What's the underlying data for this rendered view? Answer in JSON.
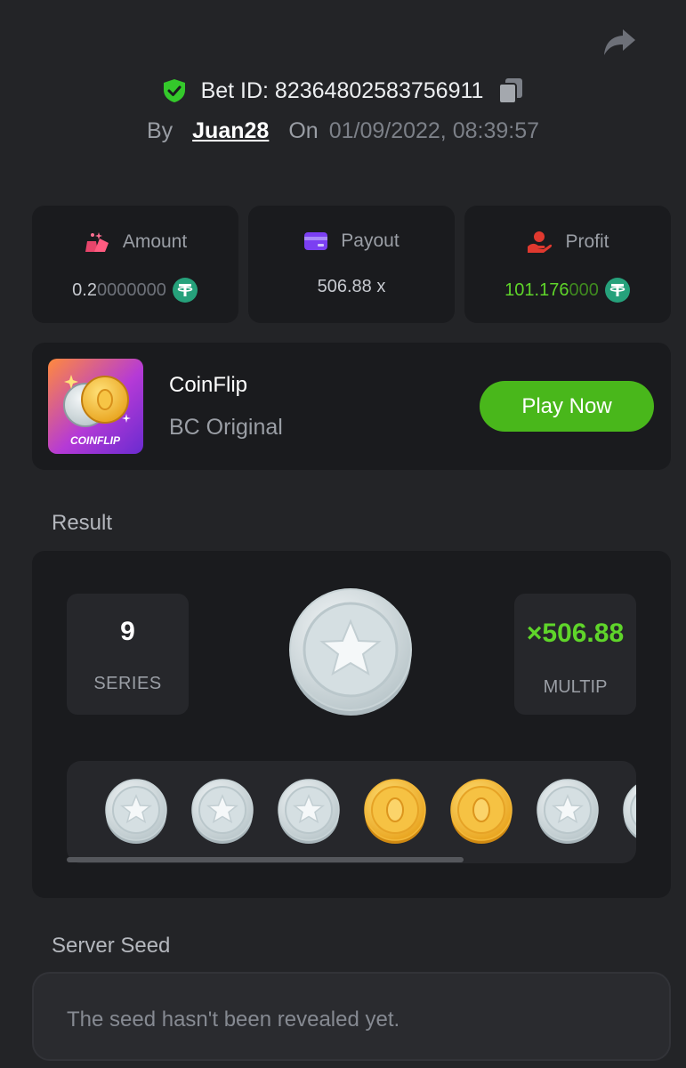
{
  "header": {
    "bet_id": "Bet ID: 82364802583756911",
    "by_label": "By",
    "username": "Juan28",
    "on_label": "On",
    "datetime": "01/09/2022, 08:39:57"
  },
  "stats": {
    "amount": {
      "label": "Amount",
      "value_main": "0.2",
      "value_dim": "0000000",
      "icon": "amount-icon"
    },
    "payout": {
      "label": "Payout",
      "value": "506.88 x",
      "icon": "payout-icon"
    },
    "profit": {
      "label": "Profit",
      "value_main": "101.176",
      "value_dim": "000",
      "icon": "profit-icon"
    }
  },
  "game": {
    "name": "CoinFlip",
    "provider": "BC Original",
    "thumb_label": "COINFLIP",
    "play_label": "Play Now"
  },
  "result": {
    "title": "Result",
    "series_value": "9",
    "series_label": "SERIES",
    "multiplier": "×506.88",
    "multiplier_label": "MULTIP",
    "main_coin": "silver",
    "coins": [
      "silver",
      "silver",
      "silver",
      "gold",
      "gold",
      "silver",
      "silver"
    ]
  },
  "server_seed": {
    "title": "Server Seed",
    "text": "The seed hasn't been revealed yet."
  },
  "colors": {
    "background": "#232427",
    "card": "#1a1b1e",
    "accent_green": "#49b71b",
    "profit_green": "#5fd52a"
  }
}
